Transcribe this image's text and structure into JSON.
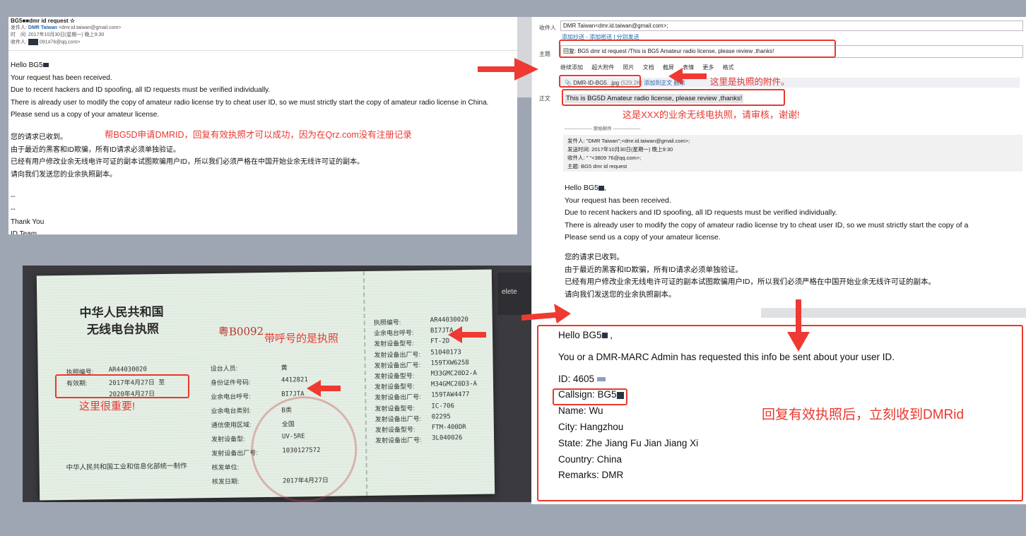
{
  "email_top": {
    "subject": "BG5■■dmr id request ☆",
    "from_label": "发件人:",
    "from_name": "DMR Taiwan",
    "from_email": "<dmr.id.taiwan@gmail.com>",
    "time_label": "时　间:",
    "time_value": "2017年10月30日(星期一) 晚上9:30",
    "to_label": "收件人:",
    "to_value": "091476@qq.com>",
    "greeting": "Hello BG5",
    "en_lines": [
      "Your request has been received.",
      "Due to recent hackers and ID spoofing, all ID requests must be verified individually.",
      "There is already user to modify the copy of amateur radio license try to cheat user ID, so we must strictly start the copy of amateur radio license in China.",
      "Please send us a copy of your amateur license."
    ],
    "cn_lines": [
      "您的请求已收到。",
      "由于最近的黑客和ID欺骗，所有ID请求必须单独验证。",
      "已经有用户修改业余无线电许可证的副本试图欺骗用户ID，所以我们必须严格在中国开始业余无线许可证的副本。",
      "请向我们发送您的业余执照副本。"
    ],
    "sig_dash1": "--",
    "sig_dash2": "--",
    "thanks": "Thank You",
    "team": "ID Team",
    "annotation": "帮BG5D申请DMRID，回复有效执照才可以成功，因为在Qrz.com没有注册记录"
  },
  "compose": {
    "to_label": "收件人",
    "to_value": "DMR Taiwan<dmr.id.taiwan@gmail.com>;",
    "cc_links": "添加抄送 - 添加密送 | 分别发送",
    "subject_label": "主题",
    "subject_value": "回复: BG5  dmr id request /This is BG5  Amateur radio license, please review ,thanks!",
    "toolbar": [
      "继续添加",
      "超大附件",
      "照片",
      "文档",
      "截屏",
      "表情",
      "更多",
      "格式"
    ],
    "attachment_name": "DMR-ID-BG5.  .jpg",
    "attachment_size": "(529.2K)",
    "attachment_actions": "添加到正文  删除",
    "attach_annotation": "这里是执照的附件。",
    "body_label": "正文",
    "body_first_line": "This is BG5D  Amateur radio license, please review ,thanks!",
    "body_annotation": "这是XXX的业余无线电执照，请审核，谢谢!",
    "original_divider": "------------------ 原始邮件 ------------------",
    "quote_from": "发件人: \"DMR Taiwan\";<dmr.id.taiwan@gmail.com>;",
    "quote_time": "发送时间: 2017年10月30日(星期一) 晚上9:30",
    "quote_to": "收件人: \"  \"<3809  76@qq.com>;",
    "quote_subject": "主题: BG5  dmr id request",
    "greeting": "Hello BG5",
    "en_lines": [
      "Your request has been received.",
      "Due to recent hackers and ID spoofing, all ID requests must be verified individually.",
      "There is already user to modify the copy of amateur radio license try to cheat user ID, so we must strictly start the copy of a",
      "Please send us a copy of your amateur license."
    ],
    "cn_lines": [
      "您的请求已收到。",
      "由于最近的黑客和ID欺骗，所有ID请求必须单独验证。",
      "已经有用户修改业余无线电许可证的副本试图欺骗用户ID，所以我们必须严格在中国开始业余无线许可证的副本。",
      "请向我们发送您的业余执照副本。"
    ]
  },
  "license": {
    "title1": "中华人民共和国",
    "title2": "无线电台执照",
    "serial": "粤B0092",
    "left_fields": [
      {
        "k": "执照编号:",
        "v": "AR44030020"
      },
      {
        "k": "有效期:",
        "v": "2017年4月27日 至"
      },
      {
        "k": "",
        "v": "2020年4月27日"
      }
    ],
    "mid_fields": [
      {
        "k": "设台人员:",
        "v": "黄"
      },
      {
        "k": "身份证件号码:",
        "v": "4412821"
      },
      {
        "k": "业余电台呼号:",
        "v": "BI7JTA"
      },
      {
        "k": "业余电台类别:",
        "v": "B类"
      },
      {
        "k": "通信使用区域:",
        "v": "全国"
      },
      {
        "k": "发射设备型:",
        "v": "UV-5RE"
      },
      {
        "k": "发射设备出厂号:",
        "v": "1030127572"
      },
      {
        "k": "核发单位:",
        "v": ""
      },
      {
        "k": "核发日期:",
        "v": "2017年4月27日"
      }
    ],
    "right_fields": [
      {
        "k": "执照编号:",
        "v": "AR44030020"
      },
      {
        "k": "业余电台呼号:",
        "v": "BI7JTA"
      },
      {
        "k": "发射设备型号:",
        "v": "FT-2D"
      },
      {
        "k": "发射设备出厂号:",
        "v": "51040173"
      },
      {
        "k": "发射设备出厂号:",
        "v": "159TXW6258"
      },
      {
        "k": "发射设备型号:",
        "v": "M33GMC20D2-A"
      },
      {
        "k": "发射设备型号:",
        "v": "M34GMC20D3-A"
      },
      {
        "k": "发射设备出厂号:",
        "v": "159TAW4477"
      },
      {
        "k": "发射设备型号:",
        "v": "IC-706"
      },
      {
        "k": "发射设备出厂号:",
        "v": "02295"
      },
      {
        "k": "发射设备型号:",
        "v": "FTM-400DR"
      },
      {
        "k": "发射设备出厂号:",
        "v": "3L040026"
      }
    ],
    "footer": "中华人民共和国工业和信息化部统一制作",
    "annotation_callsign": "带呼号的是执照",
    "annotation_important": "这里很重要!",
    "keycap": "elete"
  },
  "dmr_reply": {
    "greeting": "Hello BG5",
    "line1": "You or a DMR-MARC Admin has requested this info be sent about your user ID.",
    "id": "ID: 4605",
    "callsign": "Callsign: BG5",
    "name": "Name: Wu",
    "city": "City: Hangzhou",
    "state": "State: Zhe Jiang  Fu Jian  Jiang Xi",
    "country": "Country: China",
    "remarks": "Remarks: DMR",
    "annotation": "回复有效执照后，立刻收到DMRid"
  },
  "colors": {
    "annotation": "#e8382f",
    "background": "#9fa6b3",
    "redact": "#2a3342"
  }
}
